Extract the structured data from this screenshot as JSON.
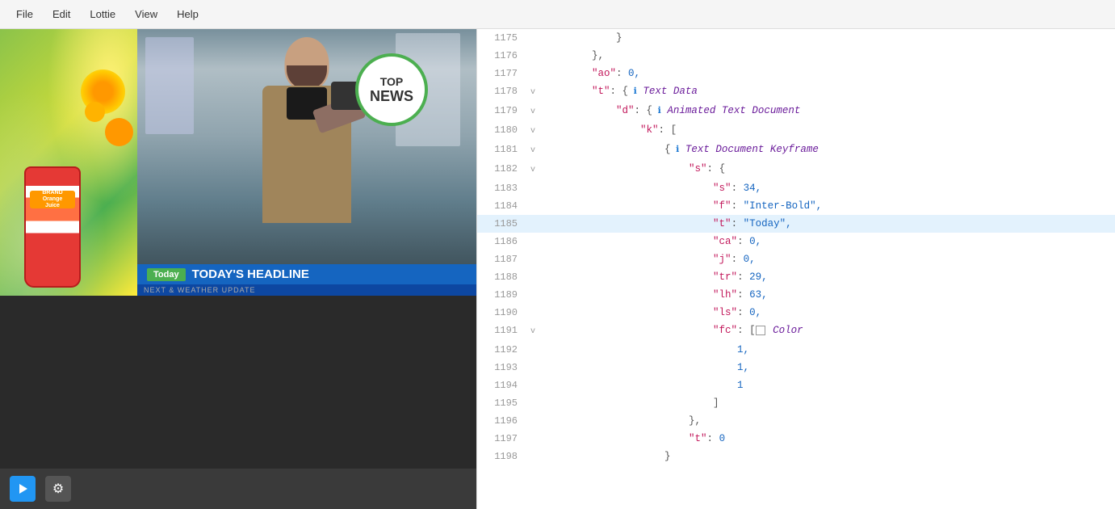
{
  "menuBar": {
    "items": [
      "File",
      "Edit",
      "Lottie",
      "View",
      "Help"
    ]
  },
  "preview": {
    "topNewsBadge": {
      "top": "TOP",
      "news": "NEWS"
    },
    "today": "Today",
    "headline": "TODAY'S HEADLINE",
    "subHeadline": "NEXT & WEATHER UPDATE"
  },
  "controls": {
    "playLabel": "play",
    "settingsLabel": "⚙"
  },
  "codeEditor": {
    "lines": [
      {
        "num": 1175,
        "toggle": "",
        "indent": "            ",
        "content": "}"
      },
      {
        "num": 1176,
        "toggle": "",
        "indent": "        ",
        "content": "},"
      },
      {
        "num": 1177,
        "toggle": "",
        "indent": "        ",
        "content": "\"ao\": 0,"
      },
      {
        "num": 1178,
        "toggle": "v",
        "indent": "        ",
        "content": "\"t\": {",
        "icon": "info",
        "label": " Text Data"
      },
      {
        "num": 1179,
        "toggle": "v",
        "indent": "            ",
        "content": "\"d\": {",
        "icon": "info",
        "label": " Animated Text Document"
      },
      {
        "num": 1180,
        "toggle": "v",
        "indent": "                ",
        "content": "\"k\": ["
      },
      {
        "num": 1181,
        "toggle": "v",
        "indent": "                    ",
        "content": "{",
        "icon": "info",
        "label": " Text Document Keyframe"
      },
      {
        "num": 1182,
        "toggle": "v",
        "indent": "                        ",
        "content": "\"s\": {"
      },
      {
        "num": 1183,
        "toggle": "",
        "indent": "                            ",
        "content": "\"s\": 34,"
      },
      {
        "num": 1184,
        "toggle": "",
        "indent": "                            ",
        "content": "\"f\": \"Inter-Bold\","
      },
      {
        "num": 1185,
        "toggle": "",
        "indent": "                            ",
        "content": "\"t\": \"Today\","
      },
      {
        "num": 1186,
        "toggle": "",
        "indent": "                            ",
        "content": "\"ca\": 0,"
      },
      {
        "num": 1187,
        "toggle": "",
        "indent": "                            ",
        "content": "\"j\": 0,"
      },
      {
        "num": 1188,
        "toggle": "",
        "indent": "                            ",
        "content": "\"tr\": 29,"
      },
      {
        "num": 1189,
        "toggle": "",
        "indent": "                            ",
        "content": "\"lh\": 63,"
      },
      {
        "num": 1190,
        "toggle": "",
        "indent": "                            ",
        "content": "\"ls\": 0,"
      },
      {
        "num": 1191,
        "toggle": "v",
        "indent": "                            ",
        "content": "\"fc\": [",
        "swatch": true,
        "label": " Color"
      },
      {
        "num": 1192,
        "toggle": "",
        "indent": "                                ",
        "content": "1,"
      },
      {
        "num": 1193,
        "toggle": "",
        "indent": "                                ",
        "content": "1,"
      },
      {
        "num": 1194,
        "toggle": "",
        "indent": "                                ",
        "content": "1"
      },
      {
        "num": 1195,
        "toggle": "",
        "indent": "                            ",
        "content": "]"
      },
      {
        "num": 1196,
        "toggle": "",
        "indent": "                        ",
        "content": "},"
      },
      {
        "num": 1197,
        "toggle": "",
        "indent": "                        ",
        "content": "\"t\": 0"
      },
      {
        "num": 1198,
        "toggle": "",
        "indent": "                    ",
        "content": "}"
      }
    ]
  }
}
